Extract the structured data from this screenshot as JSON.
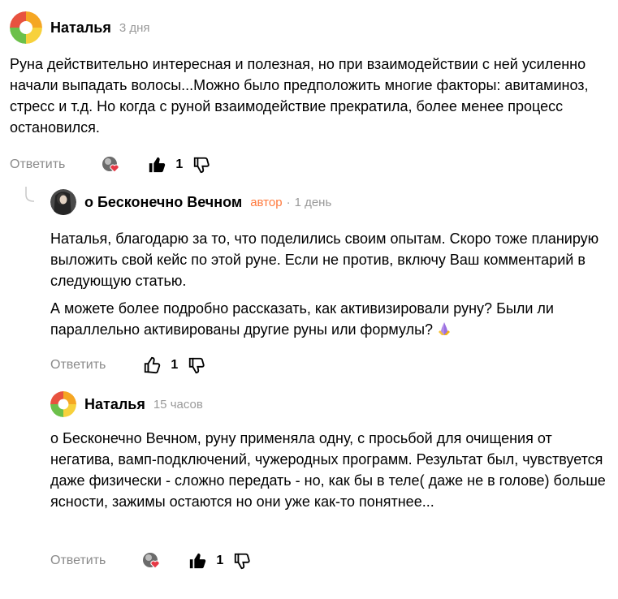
{
  "comments": [
    {
      "author": "Наталья",
      "time": "3 дня",
      "paragraphs": [
        "Руна действительно интересная и полезная, но при взаимодействии с ней усиленно начали выпадать волосы...Можно было предположить многие факторы: авитаминоз, стресс и т.д. Но когда с руной взаимодействие прекратила, более менее процесс остановился."
      ],
      "reply_label": "Ответить",
      "likes": "1"
    },
    {
      "author": "о Бесконечно Вечном",
      "author_badge": "автор",
      "separator": "·",
      "time": "1 день",
      "paragraphs": [
        "Наталья, благодарю за то, что поделились своим опытам. Скоро тоже планирую выложить свой кейс по этой руне. Если не против, включу Ваш комментарий в следующую статью.",
        "А можете более подробно рассказать, как активизировали руну? Были ли параллельно активированы другие руны или формулы?"
      ],
      "reply_label": "Ответить",
      "likes": "1"
    },
    {
      "author": "Наталья",
      "time": "15 часов",
      "paragraphs": [
        "о Бесконечно Вечном, руну применяла одну, с просьбой для очищения от негатива, вамп-подключений, чужеродных программ. Результат был, чувствуется даже физически - сложно передать - но, как бы в теле( даже не в голове) больше ясности, зажимы остаются но они уже как-то понятнее..."
      ],
      "reply_label": "Ответить",
      "likes": "1"
    }
  ],
  "icons": {
    "like_filled": "thumbs-up-icon",
    "like_outline": "thumbs-up-outline-icon",
    "dislike": "thumbs-down-icon",
    "reactor": "author-heart-reaction-icon",
    "emoji": "praying-hands-emoji"
  },
  "colors": {
    "author_badge": "#ff7a3d",
    "muted": "#8a8a8a"
  }
}
